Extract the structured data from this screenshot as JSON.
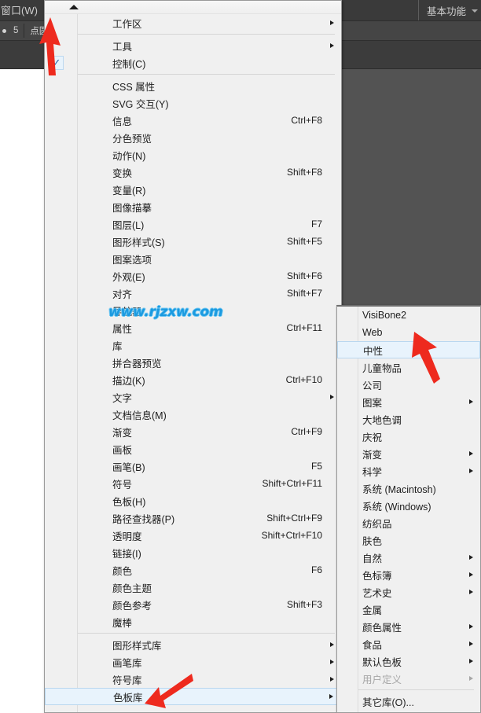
{
  "app": {
    "menubar": {
      "window_menu_label": "窗口(W)",
      "workspace_label": "基本功能",
      "workspace_caret_icon": "chevron-down-icon"
    },
    "options_bar": {
      "stroke_weight": "5",
      "shape_label": "点圆形"
    }
  },
  "watermark": {
    "text": "www.rjzxw.com"
  },
  "window_menu": {
    "scroll_up_icon": "scroll-up-arrow-icon",
    "items": [
      {
        "label": "工作区",
        "accel": "",
        "submenu": true
      },
      {
        "type": "separator"
      },
      {
        "label": "工具",
        "accel": "",
        "submenu": true
      },
      {
        "label": "控制(C)",
        "accel": "",
        "submenu": false,
        "checked": true
      },
      {
        "type": "separator"
      },
      {
        "label": "CSS 属性",
        "accel": "",
        "submenu": false
      },
      {
        "label": "SVG 交互(Y)",
        "accel": "",
        "submenu": false
      },
      {
        "label": "信息",
        "accel": "Ctrl+F8",
        "submenu": false
      },
      {
        "label": "分色预览",
        "accel": "",
        "submenu": false
      },
      {
        "label": "动作(N)",
        "accel": "",
        "submenu": false
      },
      {
        "label": "变换",
        "accel": "Shift+F8",
        "submenu": false
      },
      {
        "label": "变量(R)",
        "accel": "",
        "submenu": false
      },
      {
        "label": "图像描摹",
        "accel": "",
        "submenu": false
      },
      {
        "label": "图层(L)",
        "accel": "F7",
        "submenu": false
      },
      {
        "label": "图形样式(S)",
        "accel": "Shift+F5",
        "submenu": false
      },
      {
        "label": "图案选项",
        "accel": "",
        "submenu": false
      },
      {
        "label": "外观(E)",
        "accel": "Shift+F6",
        "submenu": false
      },
      {
        "label": "对齐",
        "accel": "Shift+F7",
        "submenu": false
      },
      {
        "label": "导航器",
        "accel": "",
        "submenu": false
      },
      {
        "label": "属性",
        "accel": "Ctrl+F11",
        "submenu": false
      },
      {
        "label": "库",
        "accel": "",
        "submenu": false
      },
      {
        "label": "拼合器预览",
        "accel": "",
        "submenu": false
      },
      {
        "label": "描边(K)",
        "accel": "Ctrl+F10",
        "submenu": false
      },
      {
        "label": "文字",
        "accel": "",
        "submenu": true
      },
      {
        "label": "文档信息(M)",
        "accel": "",
        "submenu": false
      },
      {
        "label": "渐变",
        "accel": "Ctrl+F9",
        "submenu": false
      },
      {
        "label": "画板",
        "accel": "",
        "submenu": false
      },
      {
        "label": "画笔(B)",
        "accel": "F5",
        "submenu": false
      },
      {
        "label": "符号",
        "accel": "Shift+Ctrl+F11",
        "submenu": false
      },
      {
        "label": "色板(H)",
        "accel": "",
        "submenu": false
      },
      {
        "label": "路径查找器(P)",
        "accel": "Shift+Ctrl+F9",
        "submenu": false
      },
      {
        "label": "透明度",
        "accel": "Shift+Ctrl+F10",
        "submenu": false
      },
      {
        "label": "链接(I)",
        "accel": "",
        "submenu": false
      },
      {
        "label": "颜色",
        "accel": "F6",
        "submenu": false
      },
      {
        "label": "颜色主题",
        "accel": "",
        "submenu": false
      },
      {
        "label": "颜色参考",
        "accel": "Shift+F3",
        "submenu": false
      },
      {
        "label": "魔棒",
        "accel": "",
        "submenu": false
      },
      {
        "type": "separator"
      },
      {
        "label": "图形样式库",
        "accel": "",
        "submenu": true
      },
      {
        "label": "画笔库",
        "accel": "",
        "submenu": true
      },
      {
        "label": "符号库",
        "accel": "",
        "submenu": true
      },
      {
        "label": "色板库",
        "accel": "",
        "submenu": true,
        "highlighted": true
      }
    ]
  },
  "swatch_submenu": {
    "items": [
      {
        "label": "VisiBone2",
        "submenu": false
      },
      {
        "label": "Web",
        "submenu": false
      },
      {
        "label": "中性",
        "submenu": false,
        "highlighted": true
      },
      {
        "label": "儿童物品",
        "submenu": false
      },
      {
        "label": "公司",
        "submenu": false
      },
      {
        "label": "图案",
        "submenu": true
      },
      {
        "label": "大地色调",
        "submenu": false
      },
      {
        "label": "庆祝",
        "submenu": false
      },
      {
        "label": "渐变",
        "submenu": true
      },
      {
        "label": "科学",
        "submenu": true
      },
      {
        "label": "系统 (Macintosh)",
        "submenu": false
      },
      {
        "label": "系统 (Windows)",
        "submenu": false
      },
      {
        "label": "纺织品",
        "submenu": false
      },
      {
        "label": "肤色",
        "submenu": false
      },
      {
        "label": "自然",
        "submenu": true
      },
      {
        "label": "色标簿",
        "submenu": true
      },
      {
        "label": "艺术史",
        "submenu": true
      },
      {
        "label": "金属",
        "submenu": false
      },
      {
        "label": "颜色属性",
        "submenu": true
      },
      {
        "label": "食品",
        "submenu": true
      },
      {
        "label": "默认色板",
        "submenu": true
      },
      {
        "label": "用户定义",
        "submenu": true,
        "disabled": true
      },
      {
        "type": "separator"
      },
      {
        "label": "其它库(O)...",
        "submenu": false
      }
    ]
  },
  "annotations": {
    "arrow_color": "#ee2a1e",
    "arrows": [
      {
        "name": "arrow-to-window-menu"
      },
      {
        "name": "arrow-to-swatch-library"
      },
      {
        "name": "arrow-to-neutral"
      }
    ]
  }
}
